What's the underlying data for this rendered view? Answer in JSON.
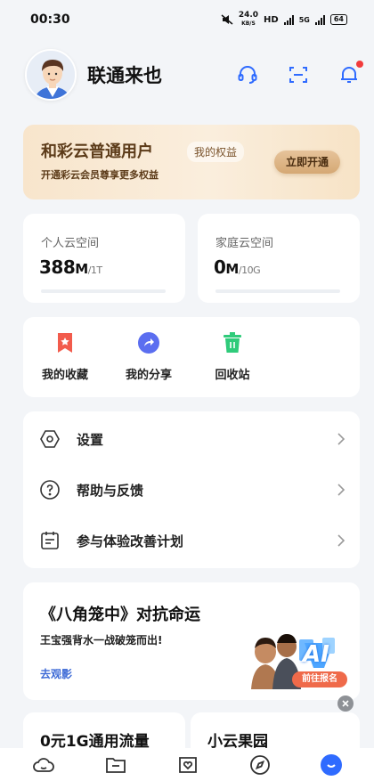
{
  "status_bar": {
    "time": "00:30",
    "speed_value": "24.0",
    "speed_unit": "KB/S",
    "hd": "HD",
    "network": "5G",
    "battery": "64"
  },
  "header": {
    "username": "联通来也",
    "icons": [
      "headset-icon",
      "scan-icon",
      "bell-icon"
    ],
    "has_notification": true
  },
  "vip": {
    "title": "和彩云普通用户",
    "benefits_pill": "我的权益",
    "subtitle": "开通彩云会员尊享更多权益",
    "cta": "立即开通"
  },
  "storage": {
    "personal": {
      "label": "个人云空间",
      "used": "388",
      "used_unit": "M",
      "total": "/1T",
      "used_fraction": 0.0004
    },
    "family": {
      "label": "家庭云空间",
      "used": "0",
      "used_unit": "M",
      "total": "/10G",
      "used_fraction": 0.0
    }
  },
  "quick_actions": [
    {
      "label": "我的收藏",
      "icon": "bookmark-icon",
      "color": "#f25b4c"
    },
    {
      "label": "我的分享",
      "icon": "share-icon",
      "color": "#5b6ef0"
    },
    {
      "label": "回收站",
      "icon": "trash-icon",
      "color": "#2fcb7a"
    }
  ],
  "menu": [
    {
      "label": "设置",
      "icon": "settings-icon"
    },
    {
      "label": "帮助与反馈",
      "icon": "help-icon"
    },
    {
      "label": "参与体验改善计划",
      "icon": "clipboard-icon"
    }
  ],
  "banner": {
    "title": "《八角笼中》对抗命运",
    "subtitle": "王宝强背水一战破笼而出!",
    "link": "去观影",
    "badge_text": "AI",
    "join_button": "前往报名"
  },
  "bottom_cards": {
    "left_title": "0元1G通用流量",
    "right_title": "小云果园"
  },
  "tabbar": {
    "tabs": [
      "cloud-icon",
      "folder-icon",
      "heart-box-icon",
      "compass-icon",
      "profile-icon"
    ],
    "active": 4
  },
  "colors": {
    "accent": "#2f6bff",
    "link": "#3d6ad6",
    "vip_text": "#5c3b19"
  }
}
